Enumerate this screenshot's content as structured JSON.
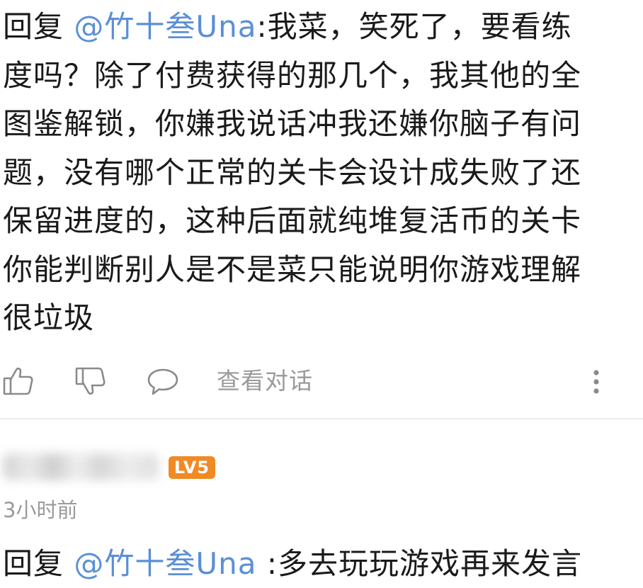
{
  "comment": {
    "reply_prefix": "回复 ",
    "mention": "@竹十叁Una",
    "lines": [
      ":我菜，笑死了，要看练",
      "度吗？除了付费获得的那几个，我其他的全",
      "图鉴解锁，你嫌我说话冲我还嫌你脑子有问",
      "题，没有哪个正常的关卡会设计成失败了还",
      "保留进度的，这种后面就纯堆复活币的关卡",
      "你能判断别人是不是菜只能说明你游戏理解",
      "很垃圾"
    ]
  },
  "actions": {
    "like_icon": "thumbs-up-icon",
    "dislike_icon": "thumbs-down-icon",
    "comment_icon": "speech-bubble-icon",
    "view_conversation_label": "查看对话",
    "more_icon": "vertical-ellipsis-icon"
  },
  "next_comment": {
    "level_badge": "LV5",
    "level_badge_color": "#f08a24",
    "timestamp": "3小时前",
    "reply_prefix": "回复 ",
    "mention": "@竹十叁Una",
    "text": " :多去玩玩游戏再来发言"
  },
  "colors": {
    "mention": "#5b8fd6",
    "text": "#1a1a1a",
    "muted": "#9a9a9a"
  }
}
